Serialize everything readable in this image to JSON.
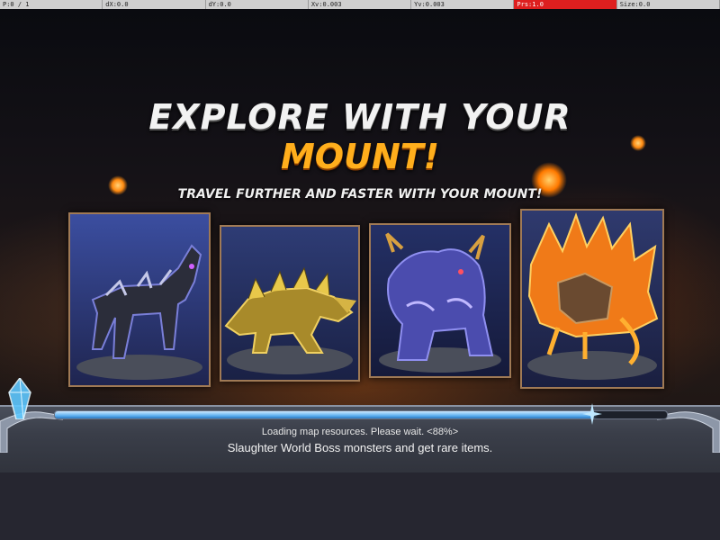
{
  "debug_bar": {
    "cells": [
      "P:0 / 1",
      "dX:0.0",
      "dY:0.0",
      "Xv:0.003",
      "Yv:0.003",
      "Prs:1.0",
      "Size:0.0"
    ]
  },
  "title": {
    "line1": "EXPLORE WITH YOUR",
    "line2": "MOUNT!"
  },
  "subtitle": "TRAVEL FURTHER AND FASTER WITH YOUR MOUNT!",
  "mounts": [
    {
      "name": "armored-horse",
      "color": "#3c3f8f"
    },
    {
      "name": "golden-dragon",
      "color": "#c9a43a"
    },
    {
      "name": "blue-beast",
      "color": "#4a4ab0"
    },
    {
      "name": "fire-lion",
      "color": "#f08a20"
    }
  ],
  "loading": {
    "progress": 0.88,
    "text": "Loading map resources. Please wait. <88%>",
    "tip": "Slaughter World Boss monsters and get rare items."
  },
  "colors": {
    "title_accent": "#ffae1c",
    "progress": "#5fb0f0",
    "alert": "#dd1f1f"
  }
}
